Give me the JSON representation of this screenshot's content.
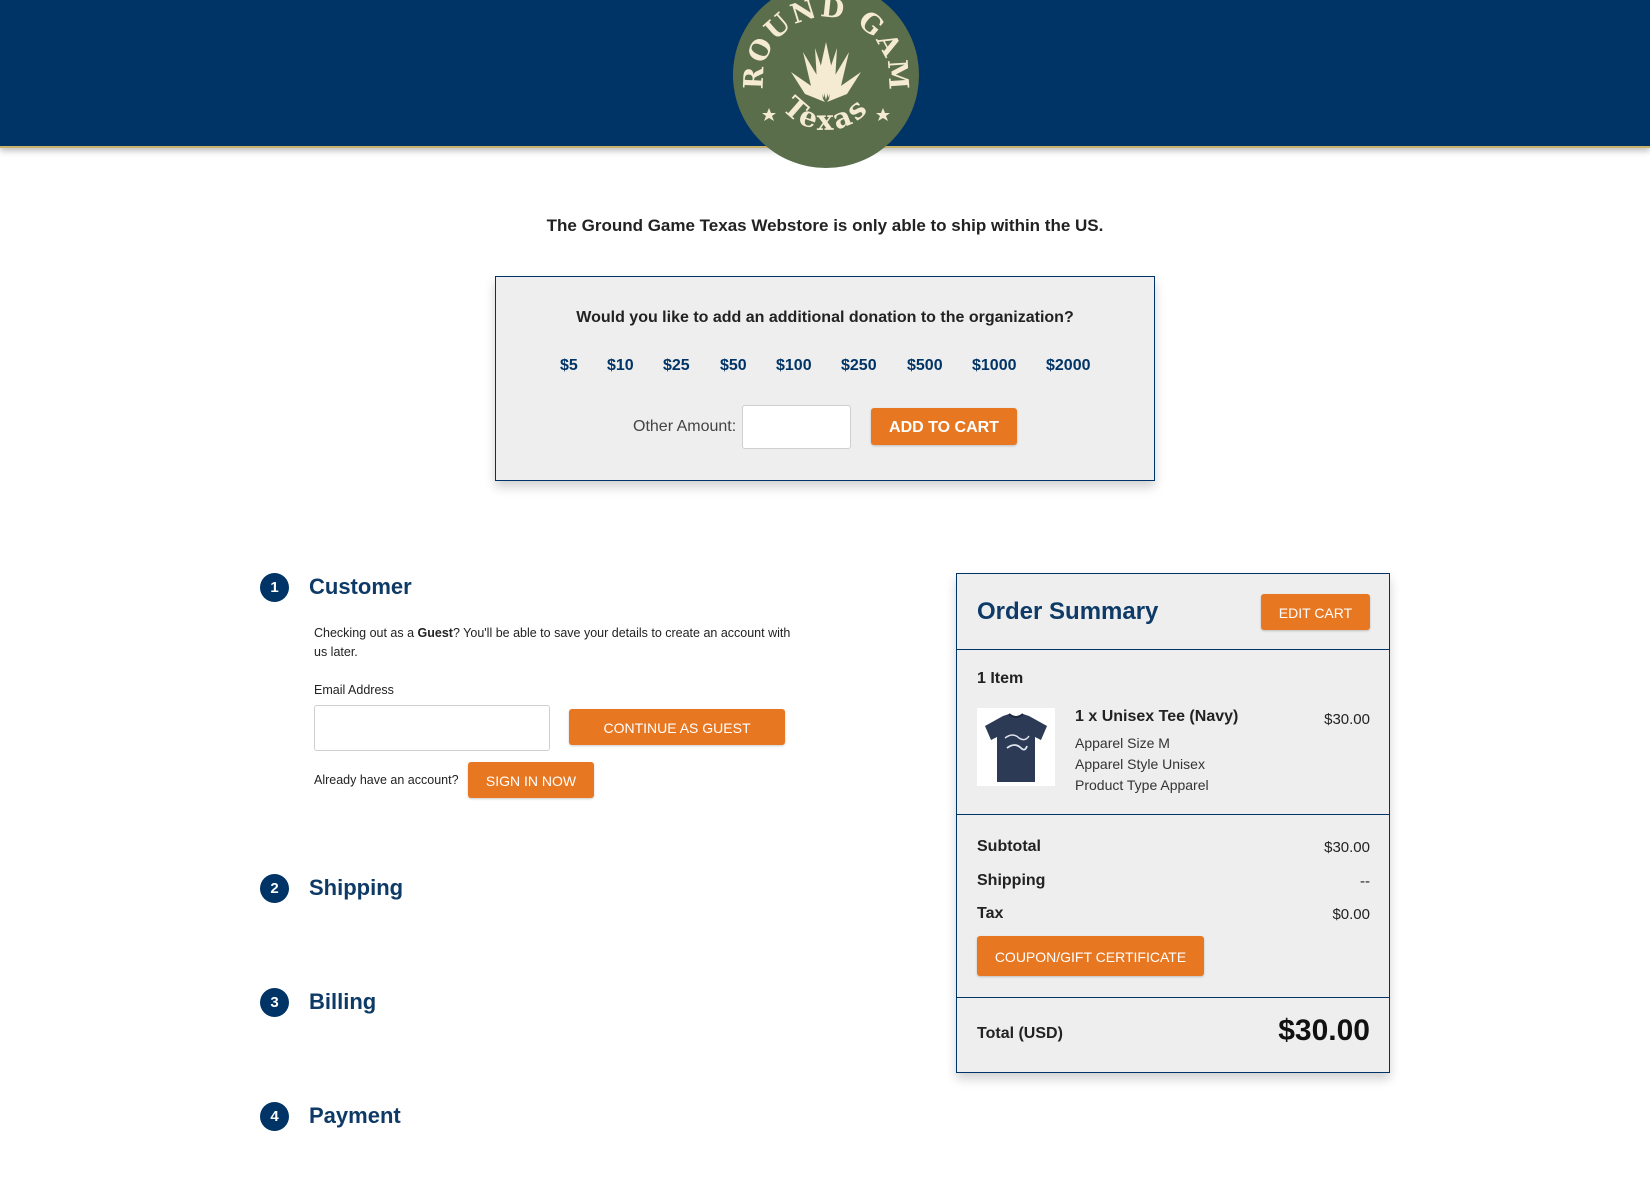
{
  "header": {
    "logo_top_text": "GROUND GAME",
    "logo_bottom_text": "Texas"
  },
  "notice": "The Ground Game Texas Webstore is only able to ship within the US.",
  "donation": {
    "question": "Would you like to add an additional donation to the organization?",
    "amounts": [
      "$5",
      "$10",
      "$25",
      "$50",
      "$100",
      "$250",
      "$500",
      "$1000",
      "$2000"
    ],
    "other_label": "Other Amount:",
    "other_value": "",
    "add_button": "ADD TO CART"
  },
  "steps": [
    {
      "num": "1",
      "title": "Customer"
    },
    {
      "num": "2",
      "title": "Shipping"
    },
    {
      "num": "3",
      "title": "Billing"
    },
    {
      "num": "4",
      "title": "Payment"
    }
  ],
  "customer": {
    "intro_before": "Checking out as a ",
    "intro_bold": "Guest",
    "intro_after": "? You'll be able to save your details to create an account with us later.",
    "email_label": "Email Address",
    "email_value": "",
    "continue_button": "CONTINUE AS GUEST",
    "account_prompt": "Already have an account?",
    "signin_button": "SIGN IN NOW"
  },
  "summary": {
    "title": "Order Summary",
    "edit_button": "EDIT CART",
    "item_count": "1 Item",
    "item": {
      "name": "1 x Unisex Tee (Navy)",
      "price": "$30.00",
      "options": [
        "Apparel Size M",
        "Apparel Style Unisex",
        "Product Type Apparel"
      ]
    },
    "subtotal_label": "Subtotal",
    "subtotal_value": "$30.00",
    "shipping_label": "Shipping",
    "shipping_value": "--",
    "tax_label": "Tax",
    "tax_value": "$0.00",
    "coupon_button": "COUPON/GIFT CERTIFICATE",
    "total_label": "Total (USD)",
    "total_value": "$30.00"
  },
  "colors": {
    "navy": "#003366",
    "orange": "#e87722",
    "logo_green": "#5a6e4b",
    "logo_cream": "#f5ead2"
  }
}
